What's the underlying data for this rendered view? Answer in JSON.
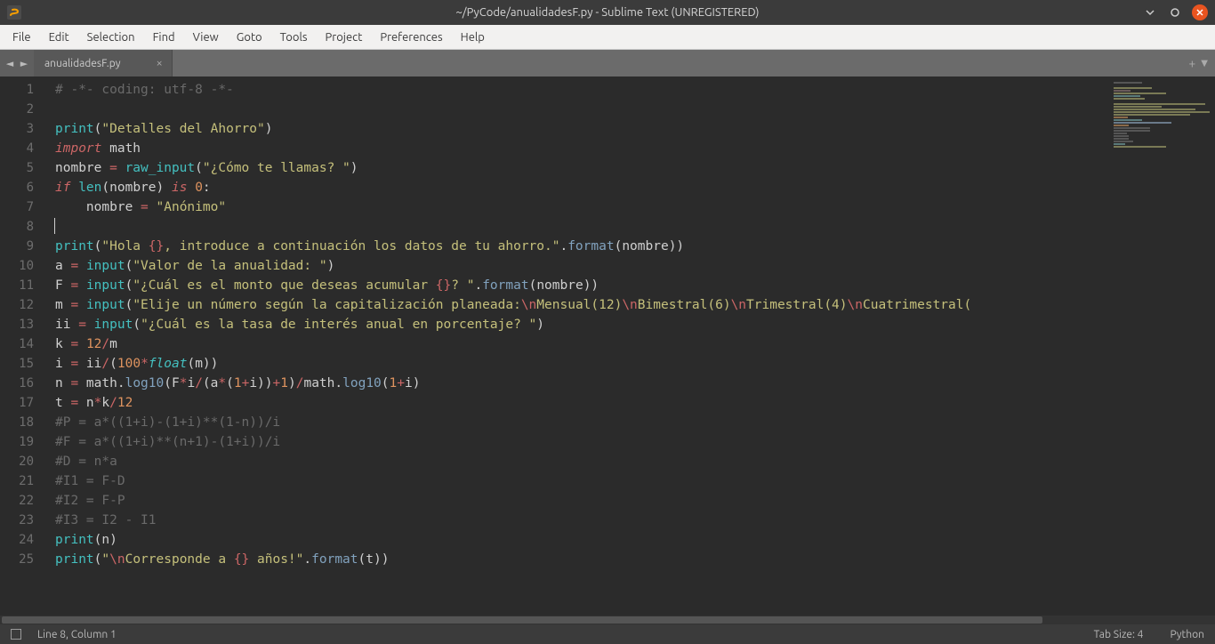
{
  "window": {
    "title": "~/PyCode/anualidadesF.py - Sublime Text (UNREGISTERED)"
  },
  "menu": {
    "items": [
      "File",
      "Edit",
      "Selection",
      "Find",
      "View",
      "Goto",
      "Tools",
      "Project",
      "Preferences",
      "Help"
    ]
  },
  "tabs": {
    "active_label": "anualidadesF.py"
  },
  "status": {
    "pos": "Line 8, Column 1",
    "tabsize": "Tab Size: 4",
    "syntax": "Python"
  },
  "gutter": {
    "lines": [
      "1",
      "2",
      "3",
      "4",
      "5",
      "6",
      "7",
      "8",
      "9",
      "10",
      "11",
      "12",
      "13",
      "14",
      "15",
      "16",
      "17",
      "18",
      "19",
      "20",
      "21",
      "22",
      "23",
      "24",
      "25"
    ]
  },
  "code": {
    "l1": "# -*- coding: utf-8 -*-",
    "l3a": "print",
    "l3b": "(",
    "l3c": "\"Detalles del Ahorro\"",
    "l3d": ")",
    "l4a": "import",
    "l4b": " math",
    "l5a": "nombre ",
    "l5b": "=",
    "l5c": " ",
    "l5d": "raw_input",
    "l5e": "(",
    "l5f": "\"¿Cómo te llamas? \"",
    "l5g": ")",
    "l6a": "if",
    "l6b": " ",
    "l6c": "len",
    "l6d": "(nombre) ",
    "l6e": "is",
    "l6f": " ",
    "l6g": "0",
    "l6h": ":",
    "l7a": "    nombre ",
    "l7b": "=",
    "l7c": " ",
    "l7d": "\"Anónimo\"",
    "l9a": "print",
    "l9b": "(",
    "l9c": "\"Hola ",
    "l9d": "{}",
    "l9e": ", introduce a continuación los datos de tu ahorro.\"",
    "l9f": ".",
    "l9g": "format",
    "l9h": "(nombre))",
    "l10a": "a ",
    "l10b": "=",
    "l10c": " ",
    "l10d": "input",
    "l10e": "(",
    "l10f": "\"Valor de la anualidad: \"",
    "l10g": ")",
    "l11a": "F ",
    "l11b": "=",
    "l11c": " ",
    "l11d": "input",
    "l11e": "(",
    "l11f": "\"¿Cuál es el monto que deseas acumular ",
    "l11g": "{}",
    "l11h": "? \"",
    "l11i": ".",
    "l11j": "format",
    "l11k": "(nombre))",
    "l12a": "m ",
    "l12b": "=",
    "l12c": " ",
    "l12d": "input",
    "l12e": "(",
    "l12f": "\"Elije un número según la capitalización planeada:",
    "l12g": "\\n",
    "l12h": "Mensual(12)",
    "l12i": "\\n",
    "l12j": "Bimestral(6)",
    "l12k": "\\n",
    "l12l": "Trimestral(4)",
    "l12m": "\\n",
    "l12n": "Cuatrimestral(",
    "l13a": "ii ",
    "l13b": "=",
    "l13c": " ",
    "l13d": "input",
    "l13e": "(",
    "l13f": "\"¿Cuál es la tasa de interés anual en porcentaje? \"",
    "l13g": ")",
    "l14a": "k ",
    "l14b": "=",
    "l14c": " ",
    "l14d": "12",
    "l14e": "/",
    "l14f": "m",
    "l15a": "i ",
    "l15b": "=",
    "l15c": " ii",
    "l15d": "/",
    "l15e": "(",
    "l15f": "100",
    "l15g": "*",
    "l15h": "float",
    "l15i": "(m))",
    "l16a": "n ",
    "l16b": "=",
    "l16c": " math.",
    "l16d": "log10",
    "l16e": "(F",
    "l16f": "*",
    "l16g": "i",
    "l16h": "/",
    "l16i": "(a",
    "l16j": "*",
    "l16k": "(",
    "l16l": "1",
    "l16m": "+",
    "l16n": "i))",
    "l16o": "+",
    "l16p": "1",
    "l16q": ")",
    "l16r": "/",
    "l16s": "math.",
    "l16t": "log10",
    "l16u": "(",
    "l16v": "1",
    "l16w": "+",
    "l16x": "i)",
    "l17a": "t ",
    "l17b": "=",
    "l17c": " n",
    "l17d": "*",
    "l17e": "k",
    "l17f": "/",
    "l17g": "12",
    "l18": "#P = a*((1+i)-(1+i)**(1-n))/i",
    "l19": "#F = a*((1+i)**(n+1)-(1+i))/i",
    "l20": "#D = n*a",
    "l21": "#I1 = F-D",
    "l22": "#I2 = F-P",
    "l23": "#I3 = I2 - I1",
    "l24a": "print",
    "l24b": "(n)",
    "l25a": "print",
    "l25b": "(",
    "l25c": "\"",
    "l25d": "\\n",
    "l25e": "Corresponde a ",
    "l25f": "{}",
    "l25g": " años!\"",
    "l25h": ".",
    "l25i": "format",
    "l25j": "(t))"
  }
}
